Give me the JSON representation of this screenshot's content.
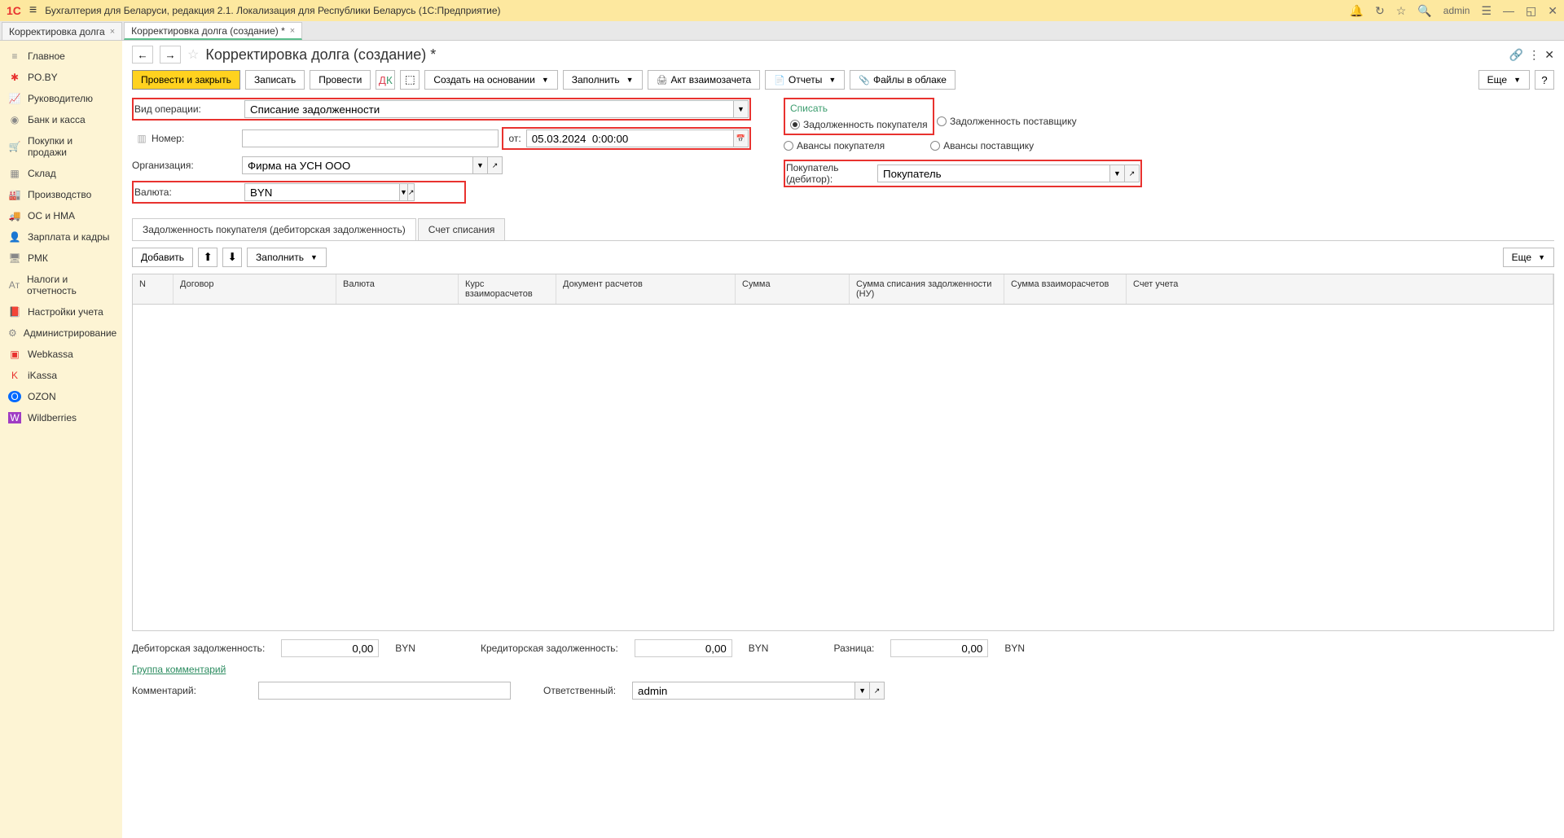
{
  "app": {
    "logo": "1С",
    "title": "Бухгалтерия для Беларуси, редакция 2.1. Локализация для Республики Беларусь   (1С:Предприятие)",
    "user": "admin"
  },
  "tabs": [
    {
      "label": "Корректировка долга",
      "active": false
    },
    {
      "label": "Корректировка долга (создание) *",
      "active": true
    }
  ],
  "sidebar": [
    {
      "icon": "≡",
      "label": "Главное"
    },
    {
      "icon": "✱",
      "label": "PO.BY",
      "color": "#e8322f"
    },
    {
      "icon": "📈",
      "label": "Руководителю"
    },
    {
      "icon": "₽",
      "label": "Банк и касса"
    },
    {
      "icon": "🛒",
      "label": "Покупки и продажи"
    },
    {
      "icon": "▦",
      "label": "Склад"
    },
    {
      "icon": "🏭",
      "label": "Производство"
    },
    {
      "icon": "🚚",
      "label": "ОС и НМА"
    },
    {
      "icon": "👤",
      "label": "Зарплата и кадры"
    },
    {
      "icon": "🖥",
      "label": "РМК"
    },
    {
      "icon": "Aт",
      "label": "Налоги и отчетность"
    },
    {
      "icon": "📕",
      "label": "Настройки учета"
    },
    {
      "icon": "⚙",
      "label": "Администрирование"
    },
    {
      "icon": "▣",
      "label": "Webkassa",
      "color": "#e8322f"
    },
    {
      "icon": "K",
      "label": "iKassa",
      "color": "#e8322f"
    },
    {
      "icon": "O",
      "label": "OZON",
      "bg": "#0069ff"
    },
    {
      "icon": "W",
      "label": "Wildberries",
      "bg": "#a03cc4"
    }
  ],
  "page": {
    "title": "Корректировка долга (создание) *"
  },
  "toolbar": {
    "post_close": "Провести и закрыть",
    "save": "Записать",
    "post": "Провести",
    "create_based": "Создать на основании",
    "fill": "Заполнить",
    "act": "Акт взаимозачета",
    "reports": "Отчеты",
    "files": "Файлы в облаке",
    "more": "Еще"
  },
  "form": {
    "operation_label": "Вид операции:",
    "operation_value": "Списание задолженности",
    "number_label": "Номер:",
    "date_label": "от:",
    "date_value": "05.03.2024  0:00:00",
    "org_label": "Организация:",
    "org_value": "Фирма на УСН ООО",
    "currency_label": "Валюта:",
    "currency_value": "BYN",
    "writeoff_title": "Списать",
    "radio1": "Задолженность покупателя",
    "radio2": "Задолженность поставщику",
    "radio3": "Авансы покупателя",
    "radio4": "Авансы поставщику",
    "buyer_label": "Покупатель (дебитор):",
    "buyer_value": "Покупатель"
  },
  "inner_tabs": [
    {
      "label": "Задолженность покупателя (дебиторская задолженность)",
      "active": true
    },
    {
      "label": "Счет списания",
      "active": false
    }
  ],
  "table_toolbar": {
    "add": "Добавить",
    "fill": "Заполнить",
    "more": "Еще"
  },
  "table": {
    "columns": [
      "N",
      "Договор",
      "Валюта",
      "Курс взаиморасчетов",
      "Документ расчетов",
      "Сумма",
      "Сумма списания задолженности (НУ)",
      "Сумма взаиморасчетов",
      "Счет учета"
    ]
  },
  "footer": {
    "debit_label": "Дебиторская задолженность:",
    "debit_value": "0,00",
    "credit_label": "Кредиторская задолженность:",
    "credit_value": "0,00",
    "diff_label": "Разница:",
    "diff_value": "0,00",
    "cur": "BYN",
    "group_comment": "Группа комментарий",
    "comment_label": "Комментарий:",
    "responsible_label": "Ответственный:",
    "responsible_value": "admin"
  }
}
